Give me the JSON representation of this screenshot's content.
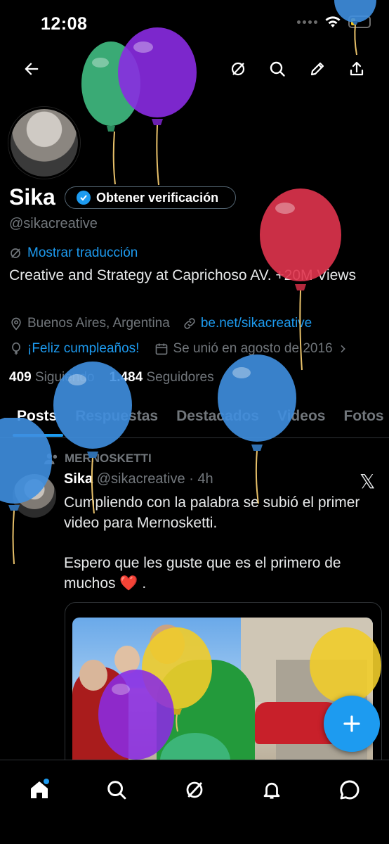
{
  "status_bar": {
    "time": "12:08"
  },
  "profile": {
    "name": "Sika",
    "verify_button": "Obtener verificación",
    "handle": "@sikacreative",
    "translate_link": "Mostrar traducción",
    "bio": "Creative and Strategy at Caprichoso AV. +20M Views",
    "location": "Buenos Aires, Argentina",
    "website": "be.net/sikacreative",
    "birthday": "¡Feliz cumpleaños!",
    "joined": "Se unió en agosto de 2016",
    "following_count": "409",
    "following_label": "Siguiendo",
    "followers_count": "1.484",
    "followers_label": "Seguidores"
  },
  "tabs": [
    "Posts",
    "Respuestas",
    "Destacados",
    "Videos",
    "Fotos"
  ],
  "post": {
    "repost_label": "MERNOSKETTI",
    "author": "Sika",
    "handle": "@sikacreative",
    "time": "· 4h",
    "text_line1": "Cumpliendo con la palabra se subió el primer video para Mernosketti.",
    "text_line2": "Espero que les guste que es el primero de muchos ❤️ ."
  },
  "colors": {
    "accent": "#1d9bf0",
    "background": "#000000",
    "secondary_text": "#71767b"
  },
  "icons": [
    "back-arrow-icon",
    "grok-icon",
    "search-icon",
    "edit-icon",
    "share-icon",
    "home-icon",
    "notifications-icon",
    "messages-icon",
    "compose-plus-icon"
  ]
}
